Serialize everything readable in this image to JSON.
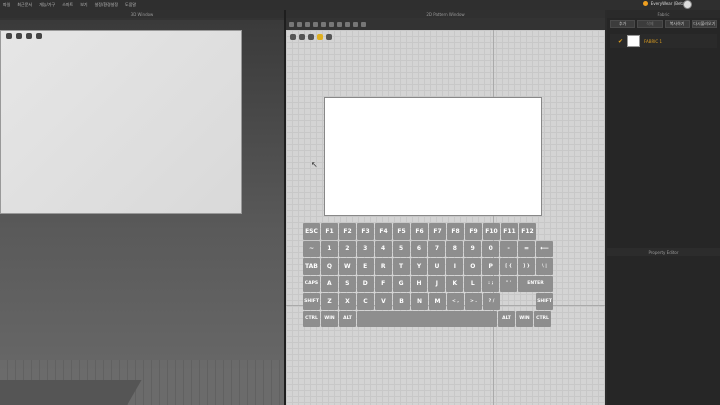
{
  "menu": [
    "파일",
    "최근문서",
    "개능/가구",
    "스마트",
    "보기",
    "설정/환경설정",
    "도움말"
  ],
  "user": {
    "name": "EveryWear (Beta)"
  },
  "panels": {
    "view3d_title": "3D Window",
    "view2d_title": "2D Pattern Window"
  },
  "right_panel": {
    "title": "Fabric",
    "buttons": [
      "추가",
      "삭제",
      "복사하기",
      "다시불러오기"
    ],
    "fabric_item": {
      "label": "FABRIC 1"
    },
    "property_title": "Property Editor"
  },
  "keyboard": {
    "rows": [
      [
        "ESC",
        "F1",
        "F2",
        "F3",
        "F4",
        "F5",
        "F6",
        "F7",
        "F8",
        "F9",
        "F10",
        "F11",
        "F12"
      ],
      [
        "~",
        "1",
        "2",
        "3",
        "4",
        "5",
        "6",
        "7",
        "8",
        "9",
        "0",
        "-",
        "=",
        "⟵"
      ],
      [
        "TAB",
        "Q",
        "W",
        "E",
        "R",
        "T",
        "Y",
        "U",
        "I",
        "O",
        "P",
        "[ {",
        "] }",
        "\\ |"
      ],
      [
        "CAPS",
        "A",
        "S",
        "D",
        "F",
        "G",
        "H",
        "J",
        "K",
        "L",
        ": ;",
        "\" '",
        "ENTER"
      ],
      [
        "SHIFT",
        "Z",
        "X",
        "C",
        "V",
        "B",
        "N",
        "M",
        "< ,",
        "> .",
        "? /",
        "SHIFT"
      ],
      [
        "CTRL",
        "WIN",
        "ALT",
        " ",
        "ALT",
        "WIN",
        "CTRL"
      ]
    ]
  }
}
